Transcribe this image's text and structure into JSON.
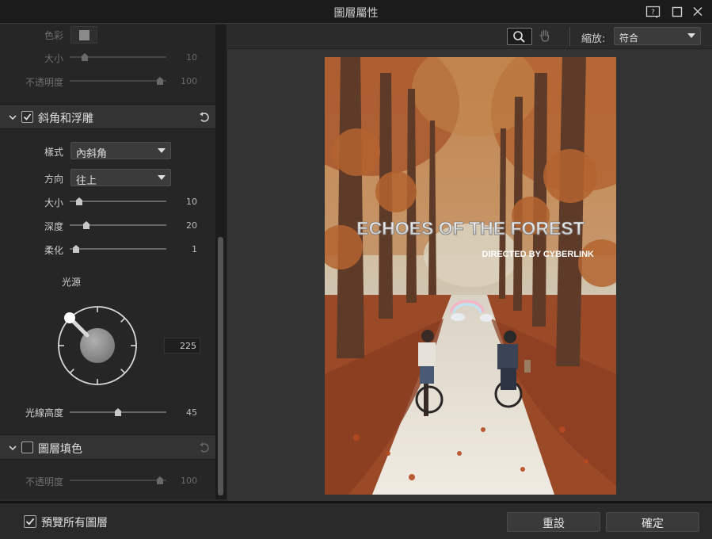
{
  "window": {
    "title": "圖層屬性"
  },
  "shadow": {
    "color_label": "色彩",
    "size_label": "大小",
    "size_value": "10",
    "size_fraction": 0.1,
    "opacity_label": "不透明度",
    "opacity_value": "100",
    "opacity_fraction": 1.0
  },
  "bevel": {
    "title": "斜角和浮雕",
    "enabled": true,
    "style_label": "樣式",
    "style_value": "內斜角",
    "direction_label": "方向",
    "direction_value": "往上",
    "size_label": "大小",
    "size_value": "10",
    "size_fraction": 0.04,
    "depth_label": "深度",
    "depth_value": "20",
    "depth_fraction": 0.12,
    "soften_label": "柔化",
    "soften_value": "1",
    "soften_fraction": 0.0,
    "light_source_label": "光源",
    "angle_value": "225",
    "altitude_label": "光線高度",
    "altitude_value": "45",
    "altitude_fraction": 0.5
  },
  "fill": {
    "title": "圖層填色",
    "enabled": false,
    "opacity_label": "不透明度",
    "opacity_value": "100",
    "opacity_fraction": 1.0
  },
  "preview": {
    "zoom_label": "縮放:",
    "zoom_value": "符合",
    "poster_title": "ECHOES OF THE FOREST",
    "poster_subtitle": "DIRECTED BY CYBERLINK"
  },
  "footer": {
    "preview_all_label": "預覽所有圖層",
    "preview_all_checked": true,
    "reset_label": "重設",
    "ok_label": "確定"
  },
  "colors": {
    "accent_gray": "#8a8a8a",
    "panel": "#262626",
    "header": "#333333"
  },
  "icons": [
    "help-icon",
    "maximize-icon",
    "close-icon",
    "chevron-down-icon",
    "checkbox-check-icon",
    "reset-icon",
    "zoom-magnifier-icon",
    "hand-pan-icon",
    "dropdown-arrow-icon"
  ]
}
